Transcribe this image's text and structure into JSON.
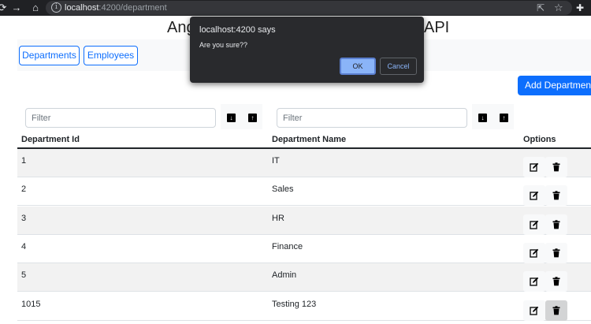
{
  "browser": {
    "url_host": "localhost",
    "url_path": ":4200/department"
  },
  "page": {
    "title_left": "Ang",
    "title_right": "API"
  },
  "navbar": {
    "departments_label": "Departments",
    "employees_label": "Employees"
  },
  "toolbar": {
    "add_label": "Add Department"
  },
  "filters": {
    "id_placeholder": "Filter",
    "name_placeholder": "Filter",
    "sort_desc_glyph": "↓",
    "sort_asc_glyph": "↑"
  },
  "table": {
    "headers": {
      "id": "Department Id",
      "name": "Department Name",
      "options": "Options"
    },
    "rows": [
      {
        "id": "1",
        "name": "IT"
      },
      {
        "id": "2",
        "name": "Sales"
      },
      {
        "id": "3",
        "name": "HR"
      },
      {
        "id": "4",
        "name": "Finance"
      },
      {
        "id": "5",
        "name": "Admin"
      },
      {
        "id": "1015",
        "name": "Testing 123"
      }
    ]
  },
  "dialog": {
    "title": "localhost:4200 says",
    "message": "Are you sure??",
    "ok_label": "OK",
    "cancel_label": "Cancel"
  },
  "colors": {
    "primary": "#0d6efd",
    "chrome_bg": "#202124",
    "dialog_bg": "#292a2d",
    "dialog_accent": "#8ab4f8"
  }
}
